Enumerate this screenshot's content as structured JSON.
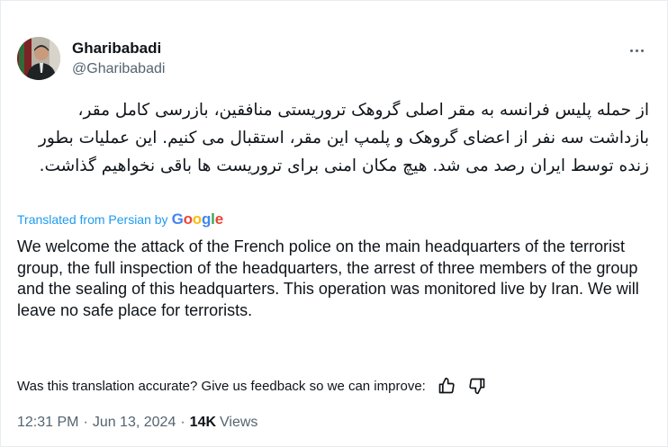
{
  "user": {
    "display_name": "Gharibabadi",
    "handle": "@Gharibabadi"
  },
  "tweet": {
    "original_text": "از حمله پلیس فرانسه به مقر اصلی گروهک تروریستی منافقین، بازرسی کامل مقر، بازداشت سه نفر از اعضای گروهک و پلمپ این مقر، استقبال می کنیم. این عملیات بطور زنده توسط ایران رصد می شد. هیچ مکان امنی برای تروریست ها باقی نخواهیم گذاشت.",
    "translated_label": "Translated from Persian by",
    "translator_brand": "Google",
    "translated_text": "We welcome the attack of the French police on the main headquarters of the terrorist group, the full inspection of the headquarters, the arrest of three members of the group and the sealing of this headquarters. This operation was monitored live by Iran. We will leave no safe place for terrorists."
  },
  "feedback": {
    "prompt": "Was this translation accurate? Give us feedback so we can improve:"
  },
  "meta": {
    "time": "12:31 PM",
    "separator_1": "·",
    "date": "Jun 13, 2024",
    "separator_2": "·",
    "views_count": "14K",
    "views_label": "Views"
  },
  "icons": {
    "more": "more-icon",
    "thumbs_up": "thumbs-up-icon",
    "thumbs_down": "thumbs-down-icon"
  },
  "colors": {
    "link_blue": "#1d9bf0",
    "secondary_text": "#536471",
    "primary_text": "#0f1419",
    "google_blue": "#4285F4",
    "google_red": "#EA4335",
    "google_yellow": "#FBBC05",
    "google_green": "#34A853"
  }
}
